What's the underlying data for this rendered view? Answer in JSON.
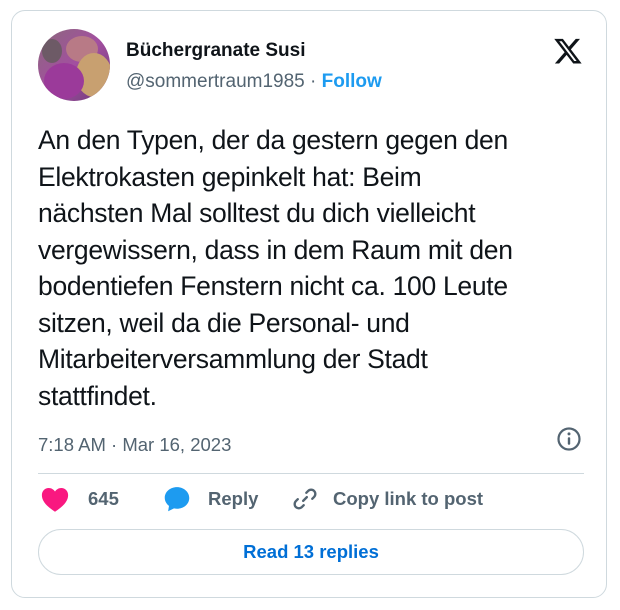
{
  "author": {
    "display_name": "Büchergranate Susi",
    "handle": "@sommertraum1985",
    "separator": "·",
    "follow_label": "Follow"
  },
  "tweet": {
    "text_lines": [
      "An den Typen, der da gestern gegen den",
      "Elektrokasten gepinkelt hat: Beim",
      "nächsten Mal solltest du dich vielleicht",
      "vergewissern, dass in dem Raum mit den",
      "bodentiefen Fenstern nicht ca. 100 Leute",
      "sitzen, weil da die Personal- und",
      "Mitarbeiterversammlung der Stadt",
      "stattfindet."
    ],
    "time": "7:18 AM",
    "separator": "·",
    "date": "Mar 16, 2023"
  },
  "actions": {
    "like_count": "645",
    "reply_label": "Reply",
    "copy_label": "Copy link to post"
  },
  "read_replies_label": "Read 13 replies",
  "icons": {
    "avatar": "profile-photo",
    "brand": "x-logo-icon",
    "info": "info-icon",
    "like": "heart-icon",
    "reply": "speech-bubble-icon",
    "copy": "link-icon"
  },
  "colors": {
    "text": "#0f1419",
    "secondary": "#536471",
    "accent": "#1d9bf0",
    "link": "#006fd6",
    "like": "#f91880",
    "border": "#cfd9de"
  }
}
